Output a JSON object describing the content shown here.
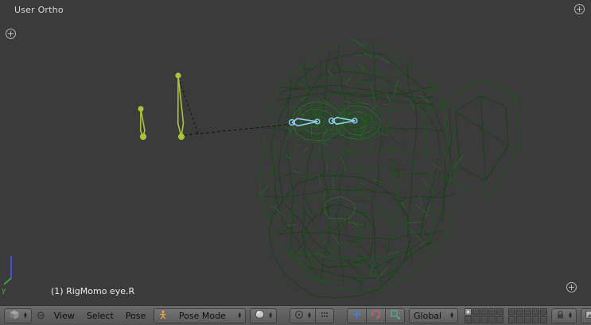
{
  "icons": {
    "collapse": "⊖",
    "region_plus": "+",
    "up": "▲",
    "down": "▼"
  },
  "viewport": {
    "view_label": "User Ortho",
    "object_label": "(1) RigMomo eye.R",
    "axis_label": "y",
    "bg_color": "#3b3b3b",
    "wire_color": "#215521",
    "bone_color": "#a8c43c",
    "selected_bone_color": "#8fd0f2"
  },
  "header": {
    "menus": [
      {
        "label": "View"
      },
      {
        "label": "Select"
      },
      {
        "label": "Pose"
      }
    ],
    "mode_dropdown": {
      "label": "Pose Mode"
    },
    "orientation_dropdown": {
      "label": "Global"
    },
    "layers": {
      "count": 20,
      "active_index": 0
    }
  }
}
